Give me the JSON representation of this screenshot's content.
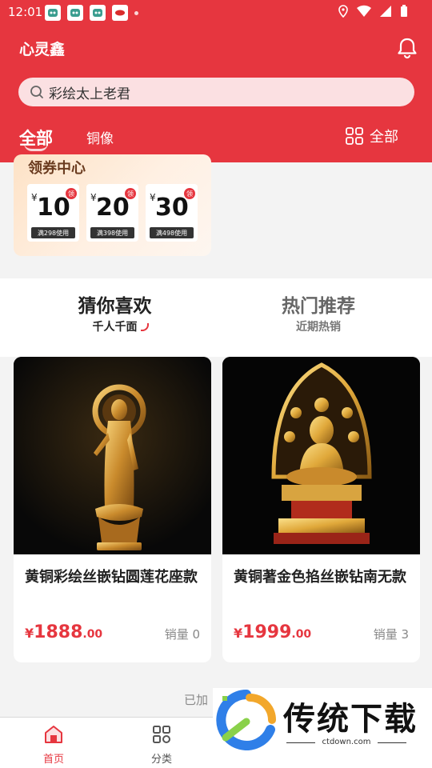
{
  "status_bar": {
    "time": "12:01"
  },
  "header": {
    "title": "心灵鑫",
    "search_query": "彩绘太上老君",
    "tabs": [
      {
        "label": "全部",
        "active": true
      },
      {
        "label": "铜像",
        "active": false
      }
    ],
    "filter_label": "全部",
    "accent_color": "#e6363f"
  },
  "coupon_center": {
    "title": "领券中心",
    "coupons": [
      {
        "currency": "¥",
        "amount": "10",
        "tag": "领",
        "condition": "满298使用"
      },
      {
        "currency": "¥",
        "amount": "20",
        "tag": "领",
        "condition": "满398使用"
      },
      {
        "currency": "¥",
        "amount": "30",
        "tag": "领",
        "condition": "满498使用"
      }
    ]
  },
  "recommend_tabs": {
    "left": {
      "title": "猜你喜欢",
      "subtitle": "千人千面"
    },
    "right": {
      "title": "热门推荐",
      "subtitle": "近期热销"
    }
  },
  "products": [
    {
      "name": "黄铜彩绘丝嵌钻圆莲花座款",
      "currency": "¥",
      "price_int": "1888",
      "price_dec": ".00",
      "sales": "销量 0"
    },
    {
      "name": "黄铜著金色掐丝嵌钻南无款",
      "currency": "¥",
      "price_int": "1999",
      "price_dec": ".00",
      "sales": "销量 3"
    }
  ],
  "feed_footer": "已加",
  "bottom_nav": [
    {
      "label": "首页",
      "icon": "home-icon",
      "active": true
    },
    {
      "label": "分类",
      "icon": "category-icon",
      "active": false
    }
  ],
  "watermark": {
    "title": "传统下载",
    "site": "ctdown.com"
  }
}
